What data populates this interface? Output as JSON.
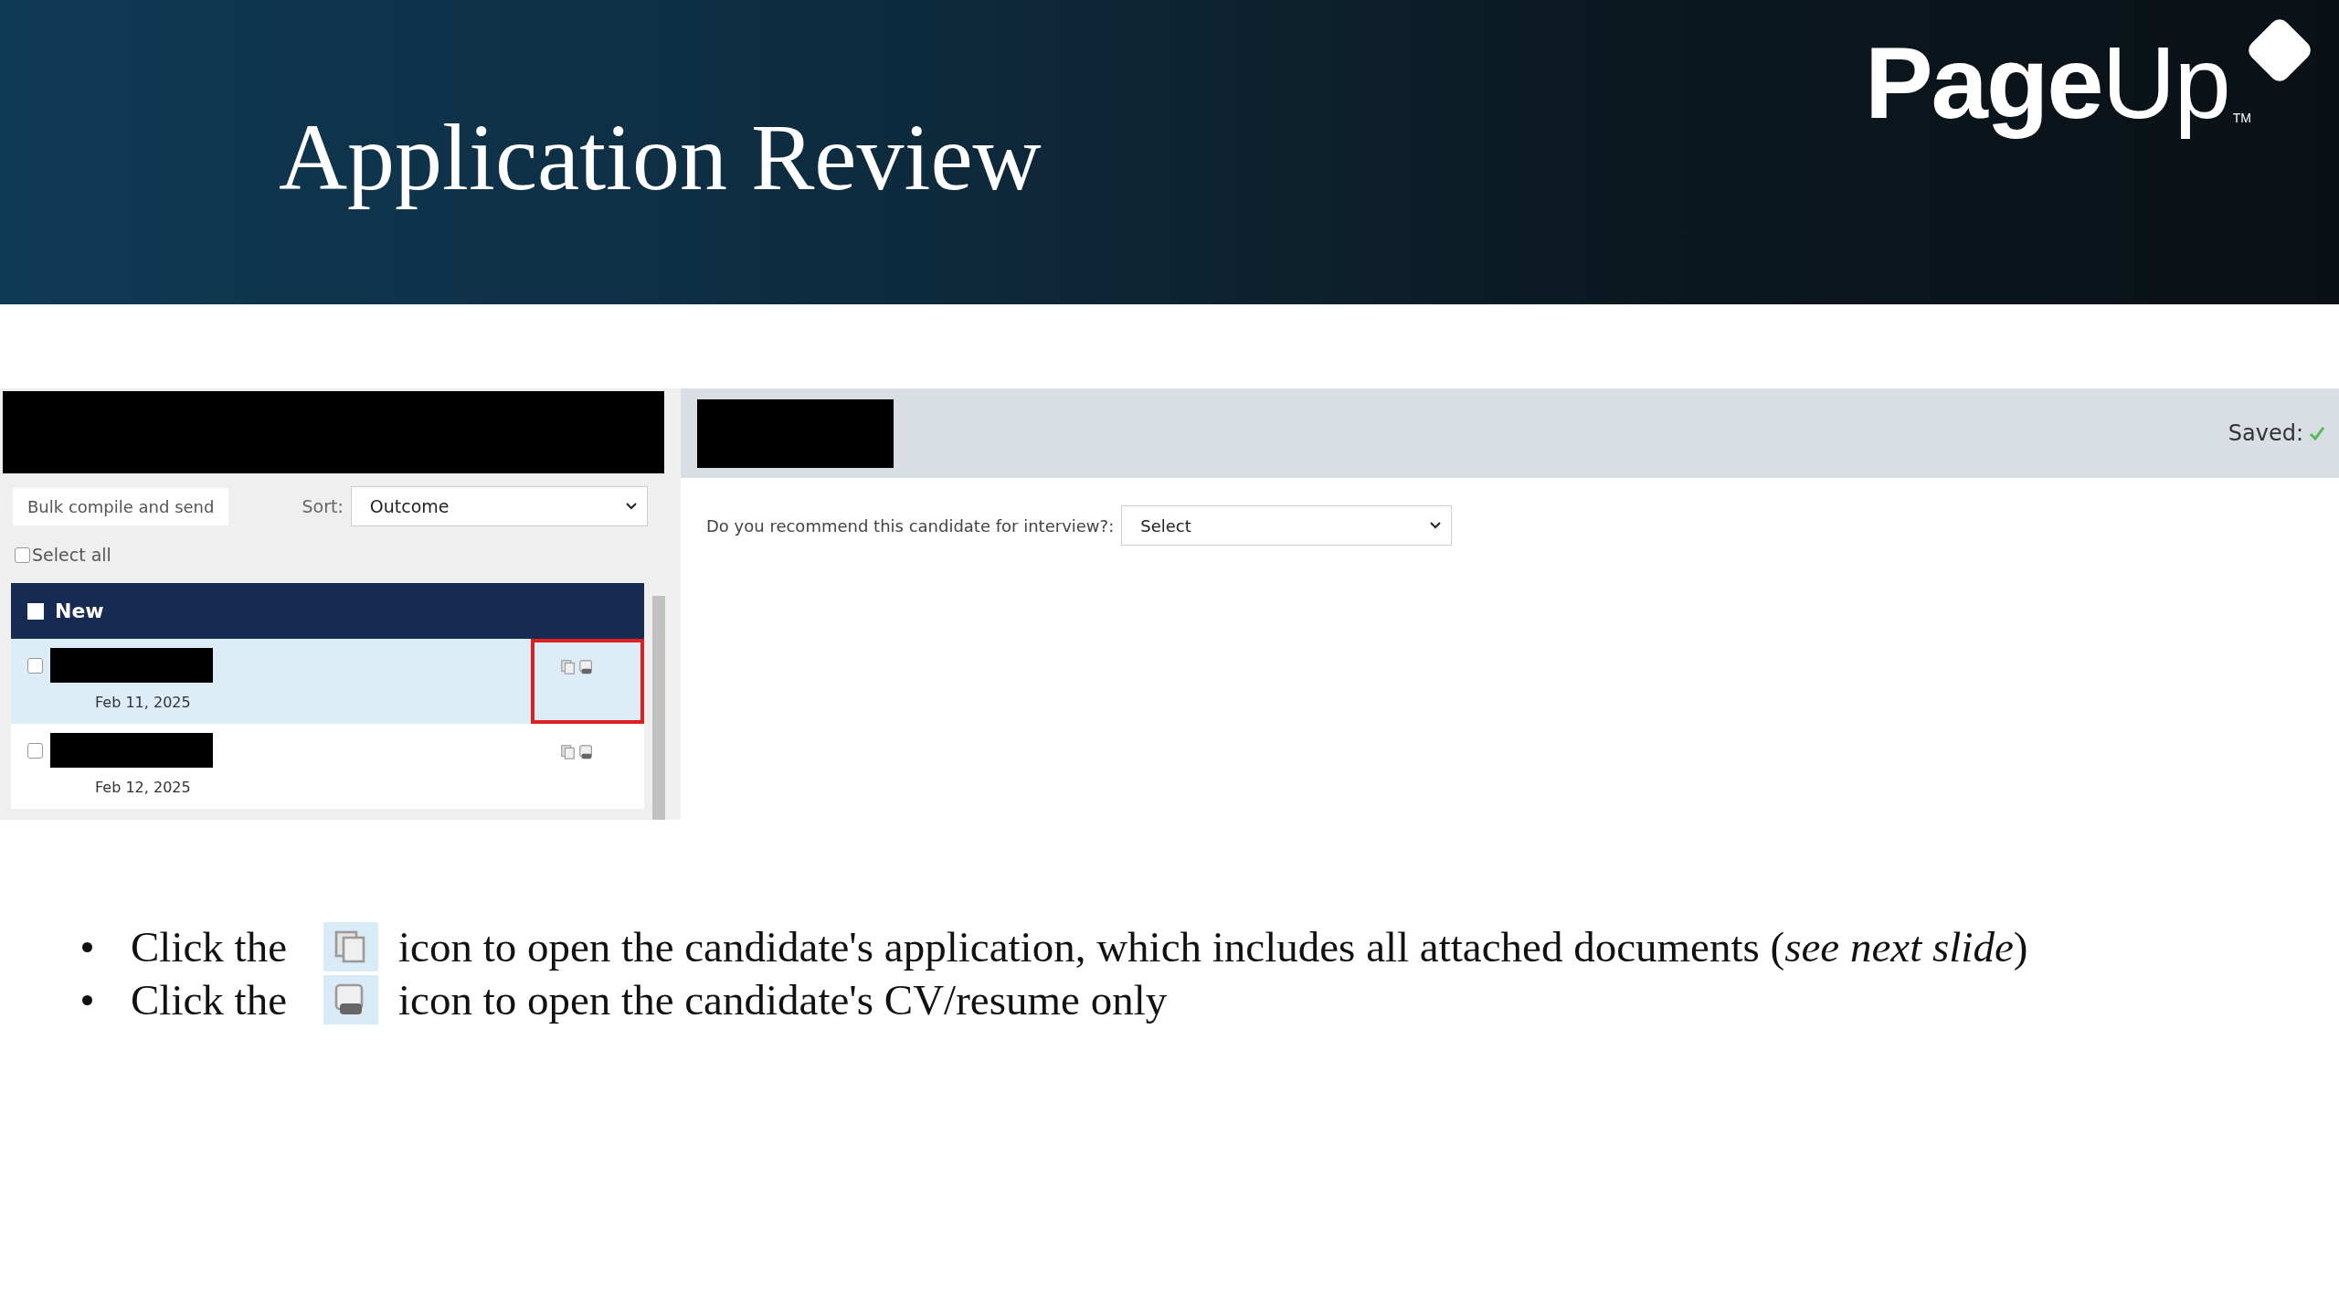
{
  "slide": {
    "title": "Application Review",
    "logo": "**Page**Up",
    "trademark": "TM"
  },
  "left_panel": {
    "bulk_button": "Bulk compile and send",
    "sort_label": "Sort:",
    "sort_value": "Outcome",
    "select_all": {
      "label": "Select all",
      "checked": false
    },
    "group": {
      "label": "New",
      "checked": false
    },
    "rows": [
      {
        "date": "Feb 11, 2025",
        "selected": true,
        "checked": false,
        "highlighted": true
      },
      {
        "date": "Feb 12, 2025",
        "selected": false,
        "checked": false,
        "highlighted": false
      }
    ]
  },
  "right_panel": {
    "saved_label": "Saved:",
    "question": "Do you recommend this candidate for interview?:",
    "answer": "Select"
  },
  "bullets": [
    {
      "lead": "Click the",
      "kind": "application",
      "text": "icon to open the candidate's application, which includes all attached documents  (*see next slide*)"
    },
    {
      "lead": "Click the",
      "kind": "resume",
      "text": "icon to open the candidate's CV/resume only"
    }
  ]
}
